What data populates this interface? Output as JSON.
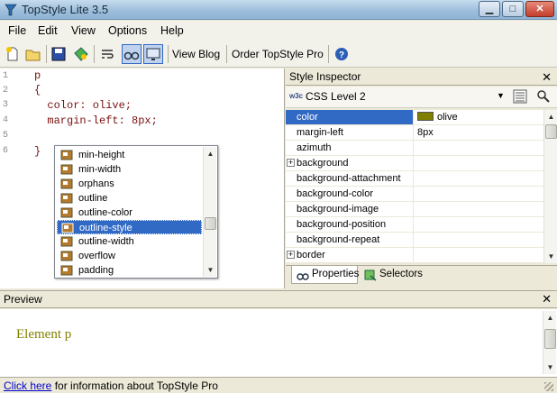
{
  "window": {
    "title": "TopStyle Lite 3.5"
  },
  "menu": [
    "File",
    "Edit",
    "View",
    "Options",
    "Help"
  ],
  "toolbar": {
    "view_blog": "View Blog",
    "order_pro": "Order TopStyle Pro"
  },
  "editor": {
    "line_numbers": [
      "1",
      "2",
      "3",
      "4",
      "5",
      "6"
    ],
    "lines": [
      "p",
      "{",
      "  color: olive;",
      "  margin-left: 8px;",
      "",
      "}"
    ]
  },
  "autocomplete": {
    "items": [
      "min-height",
      "min-width",
      "orphans",
      "outline",
      "outline-color",
      "outline-style",
      "outline-width",
      "overflow",
      "padding"
    ],
    "selected": "outline-style"
  },
  "inspector": {
    "title": "Style Inspector",
    "level_badge": "w3c",
    "level": "CSS Level 2",
    "properties": [
      {
        "name": "color",
        "value": "olive",
        "swatch": "#808000",
        "selected": true
      },
      {
        "name": "margin-left",
        "value": "8px"
      },
      {
        "name": "azimuth",
        "value": ""
      },
      {
        "name": "background",
        "value": "",
        "expandable": true
      },
      {
        "name": "background-attachment",
        "value": ""
      },
      {
        "name": "background-color",
        "value": ""
      },
      {
        "name": "background-image",
        "value": ""
      },
      {
        "name": "background-position",
        "value": ""
      },
      {
        "name": "background-repeat",
        "value": ""
      },
      {
        "name": "border",
        "value": "",
        "expandable": true
      }
    ],
    "tabs": [
      "Properties",
      "Selectors"
    ]
  },
  "preview": {
    "title": "Preview",
    "content": "Element p"
  },
  "status": {
    "link": "Click here",
    "text": " for information about TopStyle Pro"
  },
  "colors": {
    "accent": "#316ac5",
    "olive": "#808000"
  }
}
